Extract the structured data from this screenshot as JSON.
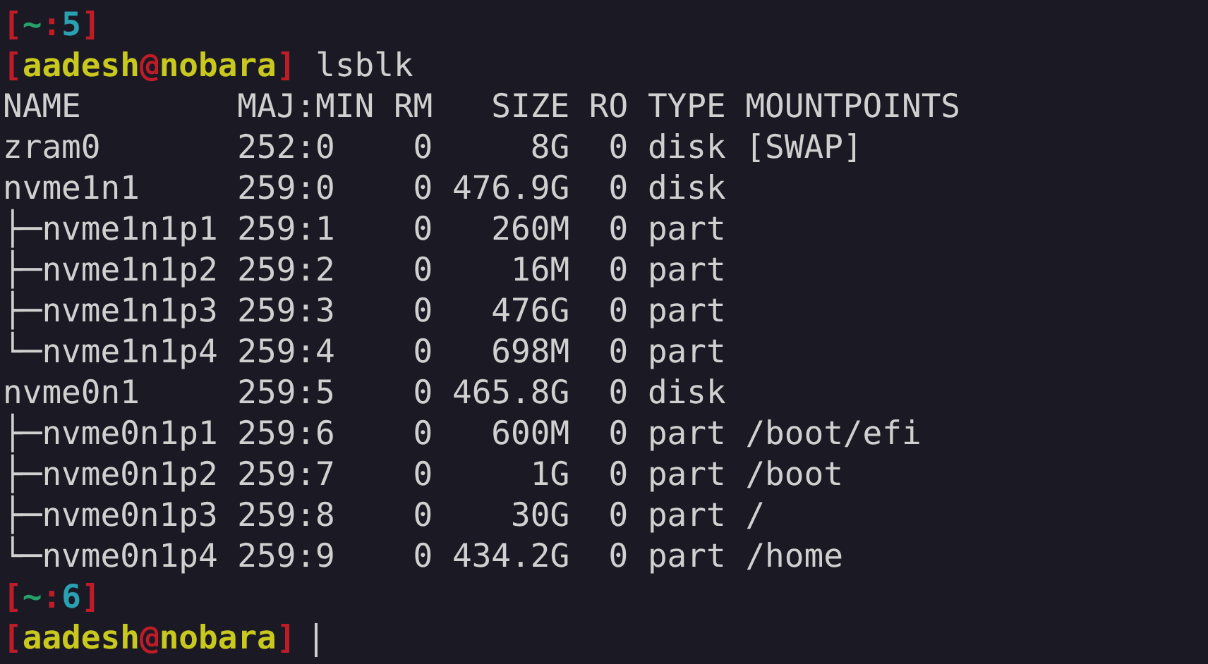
{
  "terminal": {
    "lines": [
      {
        "kind": "prompt",
        "segments": [
          {
            "kind": "bracket",
            "text": "[",
            "color": "#c01c28"
          },
          {
            "kind": "dir",
            "text": "~",
            "color": "#26a269"
          },
          {
            "kind": "separator",
            "text": ":",
            "color": "#c01c28"
          },
          {
            "kind": "count",
            "text": "5",
            "color": "#2aa1b3"
          },
          {
            "kind": "bracket",
            "text": "]",
            "color": "#c01c28"
          }
        ]
      },
      {
        "kind": "prompt",
        "cursor": false,
        "segments": [
          {
            "kind": "bracket",
            "text": "[",
            "color": "#c01c28"
          },
          {
            "kind": "user",
            "text": "aadesh",
            "color": "#c8c81e"
          },
          {
            "kind": "at",
            "text": "@",
            "color": "#c01c28"
          },
          {
            "kind": "host",
            "text": "nobara",
            "color": "#c8c81e"
          },
          {
            "kind": "bracket",
            "text": "]",
            "color": "#c01c28"
          },
          {
            "kind": "command",
            "text": " lsblk",
            "color": "#d0d0d0"
          }
        ]
      },
      {
        "kind": "output",
        "text": "NAME        MAJ:MIN RM   SIZE RO TYPE MOUNTPOINTS"
      },
      {
        "kind": "output",
        "text": "zram0       252:0    0     8G  0 disk [SWAP]"
      },
      {
        "kind": "output",
        "text": "nvme1n1     259:0    0 476.9G  0 disk"
      },
      {
        "kind": "output",
        "text": "├─nvme1n1p1 259:1    0   260M  0 part"
      },
      {
        "kind": "output",
        "text": "├─nvme1n1p2 259:2    0    16M  0 part"
      },
      {
        "kind": "output",
        "text": "├─nvme1n1p3 259:3    0   476G  0 part"
      },
      {
        "kind": "output",
        "text": "└─nvme1n1p4 259:4    0   698M  0 part"
      },
      {
        "kind": "output",
        "text": "nvme0n1     259:5    0 465.8G  0 disk"
      },
      {
        "kind": "output",
        "text": "├─nvme0n1p1 259:6    0   600M  0 part /boot/efi"
      },
      {
        "kind": "output",
        "text": "├─nvme0n1p2 259:7    0     1G  0 part /boot"
      },
      {
        "kind": "output",
        "text": "├─nvme0n1p3 259:8    0    30G  0 part /"
      },
      {
        "kind": "output",
        "text": "└─nvme0n1p4 259:9    0 434.2G  0 part /home"
      },
      {
        "kind": "prompt",
        "segments": [
          {
            "kind": "bracket",
            "text": "[",
            "color": "#c01c28"
          },
          {
            "kind": "dir",
            "text": "~",
            "color": "#26a269"
          },
          {
            "kind": "separator",
            "text": ":",
            "color": "#c01c28"
          },
          {
            "kind": "count",
            "text": "6",
            "color": "#2aa1b3"
          },
          {
            "kind": "bracket",
            "text": "]",
            "color": "#c01c28"
          }
        ]
      },
      {
        "kind": "prompt",
        "cursor": true,
        "segments": [
          {
            "kind": "bracket",
            "text": "[",
            "color": "#c01c28"
          },
          {
            "kind": "user",
            "text": "aadesh",
            "color": "#c8c81e"
          },
          {
            "kind": "at",
            "text": "@",
            "color": "#c01c28"
          },
          {
            "kind": "host",
            "text": "nobara",
            "color": "#c8c81e"
          },
          {
            "kind": "bracket",
            "text": "]",
            "color": "#c01c28"
          }
        ]
      }
    ]
  }
}
